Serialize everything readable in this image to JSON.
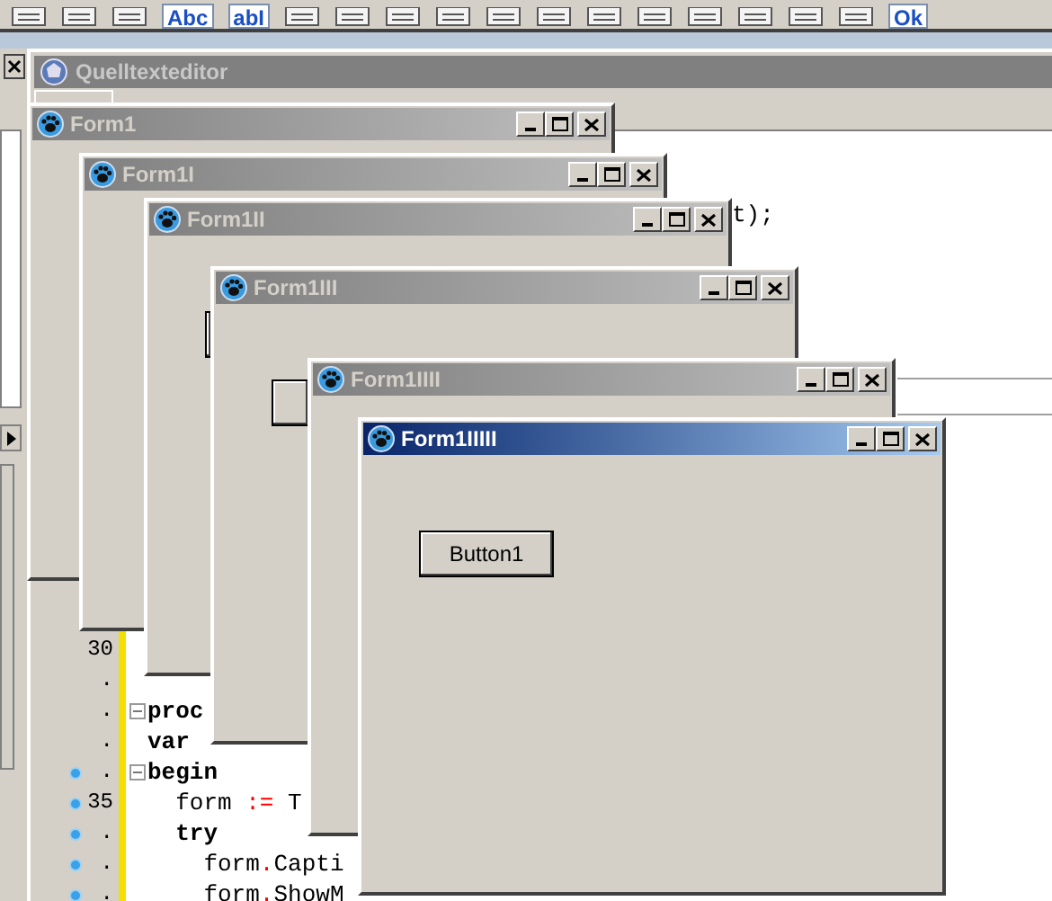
{
  "toolbar": [
    {
      "kind": "icon"
    },
    {
      "kind": "icon"
    },
    {
      "kind": "icon"
    },
    {
      "kind": "text",
      "text": "Abc"
    },
    {
      "kind": "text",
      "text": "abI"
    },
    {
      "kind": "icon"
    },
    {
      "kind": "icon"
    },
    {
      "kind": "icon"
    },
    {
      "kind": "icon"
    },
    {
      "kind": "icon"
    },
    {
      "kind": "icon"
    },
    {
      "kind": "icon"
    },
    {
      "kind": "icon"
    },
    {
      "kind": "icon"
    },
    {
      "kind": "icon"
    },
    {
      "kind": "icon"
    },
    {
      "kind": "icon"
    },
    {
      "kind": "text",
      "text": "Ok"
    }
  ],
  "editor": {
    "title": "Quelltexteditor",
    "active": false,
    "code_fragment": "t);",
    "rows": [
      {
        "number": "30",
        "breakpoint": false,
        "fold": false
      },
      {
        "number": ".",
        "breakpoint": false,
        "fold": false
      },
      {
        "number": ".",
        "breakpoint": false,
        "fold": true,
        "tokens": [
          {
            "kind": "keyword",
            "text": "proc"
          }
        ]
      },
      {
        "number": ".",
        "breakpoint": false,
        "fold": false,
        "tokens": [
          {
            "kind": "keyword",
            "text": "var"
          }
        ]
      },
      {
        "number": ".",
        "breakpoint": true,
        "fold": true,
        "tokens": [
          {
            "kind": "keyword",
            "text": "begin"
          }
        ]
      },
      {
        "number": "35",
        "breakpoint": true,
        "fold": false,
        "tokens": [
          {
            "kind": "plain",
            "text": "  form "
          },
          {
            "kind": "symbol",
            "text": ":="
          },
          {
            "kind": "plain",
            "text": " T"
          }
        ]
      },
      {
        "number": ".",
        "breakpoint": true,
        "fold": false,
        "tokens": [
          {
            "kind": "keyword",
            "text": "  try"
          }
        ]
      },
      {
        "number": ".",
        "breakpoint": true,
        "fold": false,
        "tokens": [
          {
            "kind": "plain",
            "text": "    form"
          },
          {
            "kind": "symbol",
            "text": "."
          },
          {
            "kind": "plain",
            "text": "Capti"
          }
        ]
      },
      {
        "number": ".",
        "breakpoint": true,
        "fold": false,
        "tokens": [
          {
            "kind": "plain",
            "text": "    form"
          },
          {
            "kind": "symbol",
            "text": "."
          },
          {
            "kind": "plain",
            "text": "ShowM"
          }
        ]
      }
    ]
  },
  "forms": [
    {
      "title": "Form1",
      "active": false
    },
    {
      "title": "Form1I",
      "active": false
    },
    {
      "title": "Form1II",
      "active": false
    },
    {
      "title": "Form1III",
      "active": false
    },
    {
      "title": "Form1IIII",
      "active": false
    },
    {
      "title": "Form1IIIII",
      "active": true,
      "button": "Button1"
    }
  ]
}
